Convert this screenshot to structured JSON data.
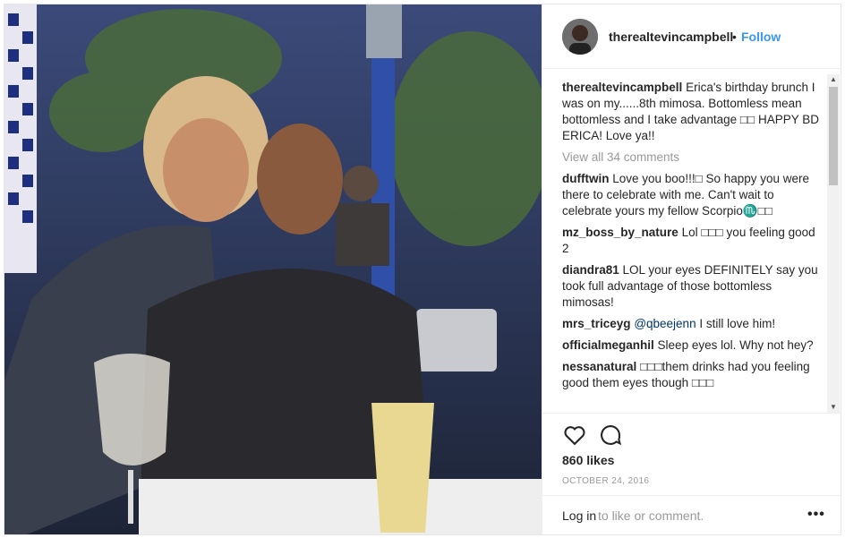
{
  "header": {
    "username": "therealtevincampbell",
    "separator": "•",
    "follow_label": "Follow"
  },
  "caption": {
    "username": "therealtevincampbell",
    "text": "Erica's birthday brunch I was on my......8th mimosa. Bottomless mean bottomless and I take advantage □□ HAPPY BD ERICA! Love ya!!"
  },
  "view_all_label": "View all 34 comments",
  "comments": [
    {
      "username": "dufftwin",
      "text": "Love you boo!!!□ So happy you were there to celebrate with me. Can't wait to celebrate yours my fellow Scorpio♏□□"
    },
    {
      "username": "mz_boss_by_nature",
      "text": "Lol □□□ you feeling good 2"
    },
    {
      "username": "diandra81",
      "text": "LOL your eyes DEFINITELY say you took full advantage of those bottomless mimosas!"
    },
    {
      "username": "mrs_triceyg",
      "mention": "@qbeejenn",
      "text": " I still love him!"
    },
    {
      "username": "officialmeganhil",
      "text": "Sleep eyes lol. Why not hey?"
    },
    {
      "username": "nessanatural",
      "text": "□□□them drinks had you feeling good them eyes though □□□"
    }
  ],
  "likes_label": "860 likes",
  "date_label": "OCTOBER 24, 2016",
  "login": {
    "link_label": "Log in",
    "rest_label": " to like or comment."
  },
  "more_label": "•••",
  "icons": {
    "heart": "heart-icon",
    "comment": "comment-bubble-icon",
    "more": "more-options-icon"
  },
  "colors": {
    "link_blue": "#3897f0",
    "muted": "#999999",
    "text": "#262626"
  }
}
